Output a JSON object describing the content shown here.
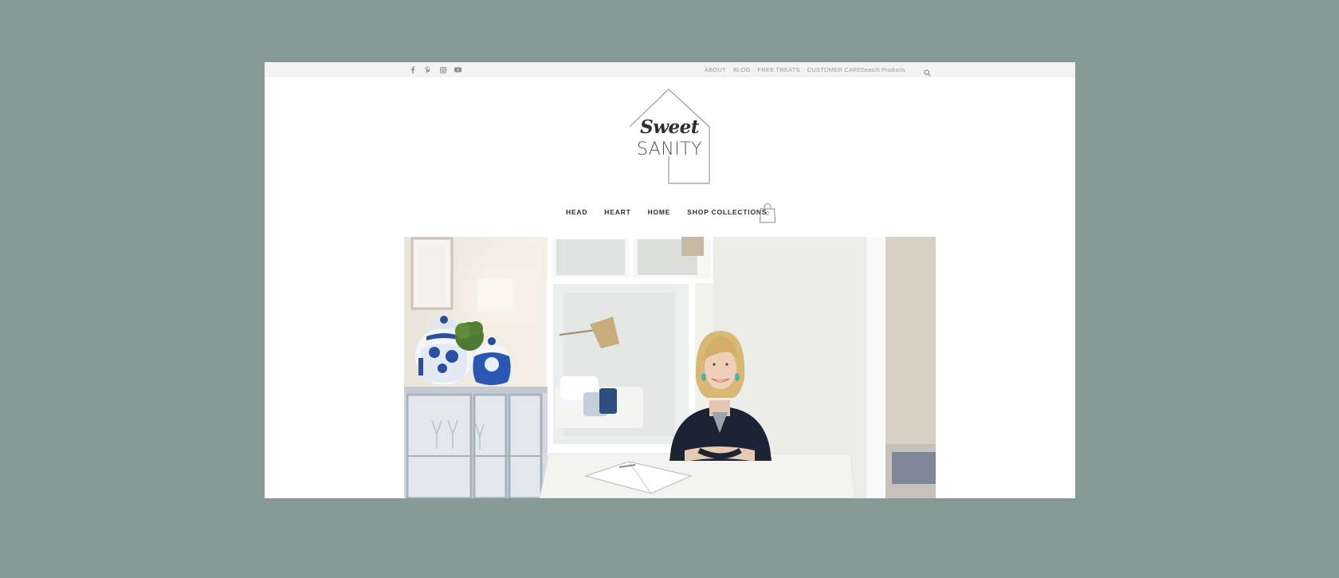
{
  "social": [
    {
      "name": "facebook-icon"
    },
    {
      "name": "pinterest-icon"
    },
    {
      "name": "instagram-icon"
    },
    {
      "name": "youtube-icon"
    }
  ],
  "toplinks": [
    "ABOUT",
    "BLOG",
    "FREE TREATS",
    "CUSTOMER CARE"
  ],
  "search": {
    "placeholder": "Search Products"
  },
  "logo": {
    "sweet": "Sweet",
    "sanity": "SANITY"
  },
  "nav": [
    "HEAD",
    "HEART",
    "HOME",
    "SHOP COLLECTIONS"
  ],
  "cart": {
    "count": "0"
  },
  "colors": {
    "page_background": "#879b96",
    "topbar": "#f3f3f3",
    "nav_text": "#2b2b2b",
    "top_link_text": "#9b9b9b"
  }
}
